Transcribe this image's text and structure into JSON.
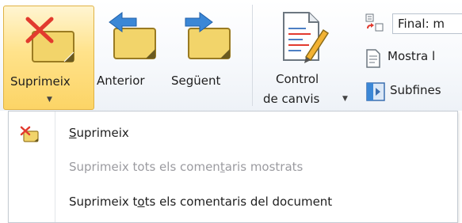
{
  "ribbon": {
    "delete_label": "Suprimeix",
    "previous_label": "Anterior",
    "next_label": "Següent",
    "track_label_line1": "Control",
    "track_label_line2": "de canvis",
    "markup_select_value": "Final: m",
    "show_markup_label": "Mostra l",
    "panes_label": "Subfines"
  },
  "menu": {
    "items": [
      {
        "pre": "",
        "key": "S",
        "post": "uprimeix",
        "enabled": true
      },
      {
        "pre": "Suprimeix tots els comen",
        "key": "t",
        "post": "aris mostrats",
        "enabled": false
      },
      {
        "pre": "Suprimeix t",
        "key": "o",
        "post": "ts els comentaris del document",
        "enabled": true
      }
    ]
  },
  "colors": {
    "accent_hover": "#ffe28a",
    "note_yellow": "#f2d46a",
    "arrow_blue": "#3b87d6",
    "delete_red": "#e23a2e"
  },
  "icons": [
    "delete-comment-icon",
    "previous-comment-icon",
    "next-comment-icon",
    "track-changes-icon",
    "markup-view-icon",
    "show-markup-icon",
    "reviewing-pane-icon"
  ]
}
